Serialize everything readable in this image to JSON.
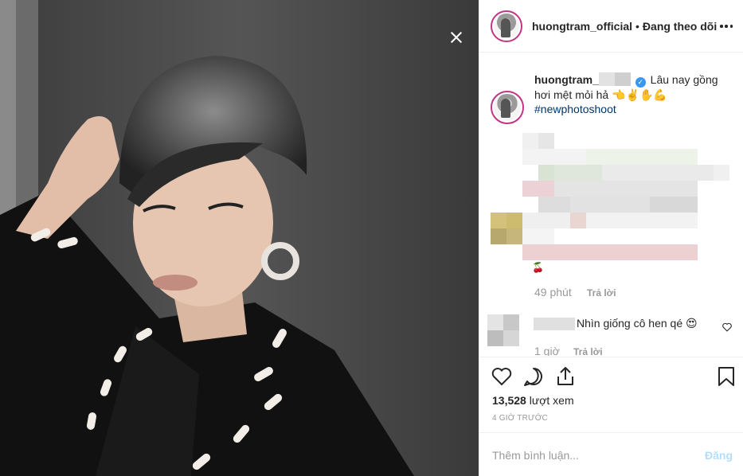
{
  "post": {
    "username": "huongtram_official",
    "separator": "•",
    "follow_status": "Đang theo dõi"
  },
  "caption": {
    "username": "huongtram_",
    "text": "Lâu nay gồng hơi mệt mỏi hả 👈✌️✋💪",
    "hashtag": "#newphotoshoot"
  },
  "comment1": {
    "emoji": "🍒",
    "time": "49 phút",
    "reply": "Trả lời"
  },
  "comment2": {
    "text": "Nhìn giống cô hen qé 😍",
    "time": "1 giờ",
    "reply": "Trả lời"
  },
  "stats": {
    "views_count": "13,528",
    "views_label": "lượt xem",
    "time_ago": "4 giờ trước"
  },
  "add_comment": {
    "placeholder": "Thêm bình luận...",
    "post_label": "Đăng"
  },
  "icons": [
    "close-icon",
    "more-icon",
    "verified-icon",
    "heart-icon",
    "comment-icon",
    "share-icon",
    "bookmark-icon"
  ],
  "colors": {
    "hashtag": "#003569",
    "verified": "#3897f0",
    "muted": "#999999",
    "post_disabled": "#b2dffc"
  }
}
